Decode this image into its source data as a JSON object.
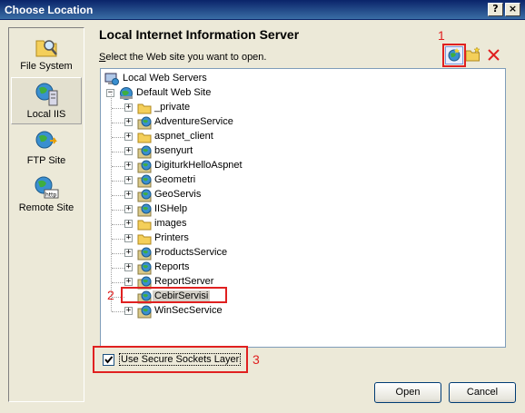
{
  "window": {
    "title": "Choose Location",
    "help_label": "?",
    "close_label": "×"
  },
  "nav": {
    "items": [
      {
        "label": "File System",
        "icon": "folder-search-icon"
      },
      {
        "label": "Local IIS",
        "icon": "iis-server-icon",
        "selected": true
      },
      {
        "label": "FTP Site",
        "icon": "ftp-globe-icon"
      },
      {
        "label": "Remote Site",
        "icon": "remote-http-icon"
      }
    ]
  },
  "main": {
    "heading": "Local Internet Information Server",
    "instruction_prefix": "S",
    "instruction_rest": "elect the Web site you want to open."
  },
  "toolbar": {
    "icons": [
      "new-web-application-icon",
      "new-virtual-directory-icon",
      "delete-icon"
    ]
  },
  "tree": {
    "root_label": "Local Web Servers",
    "site_label": "Default Web Site",
    "children": [
      {
        "label": "_private",
        "type": "folder"
      },
      {
        "label": "AdventureService",
        "type": "app"
      },
      {
        "label": "aspnet_client",
        "type": "folder"
      },
      {
        "label": "bsenyurt",
        "type": "app"
      },
      {
        "label": "DigiturkHelloAspnet",
        "type": "app"
      },
      {
        "label": "Geometri",
        "type": "app"
      },
      {
        "label": "GeoServis",
        "type": "app"
      },
      {
        "label": "IISHelp",
        "type": "app"
      },
      {
        "label": "images",
        "type": "folder"
      },
      {
        "label": "Printers",
        "type": "folder"
      },
      {
        "label": "ProductsService",
        "type": "app"
      },
      {
        "label": "Reports",
        "type": "app"
      },
      {
        "label": "ReportServer",
        "type": "app"
      },
      {
        "label": "CebirServisi",
        "type": "app",
        "selected": true
      },
      {
        "label": "WinSecService",
        "type": "app"
      }
    ]
  },
  "callouts": [
    "1",
    "2",
    "3"
  ],
  "ssl": {
    "label": "Use Secure Sockets Layer",
    "checked": true
  },
  "buttons": {
    "open": "Open",
    "cancel": "Cancel"
  },
  "colors": {
    "callout": "#e02020",
    "title_bar": "#0a246a"
  }
}
